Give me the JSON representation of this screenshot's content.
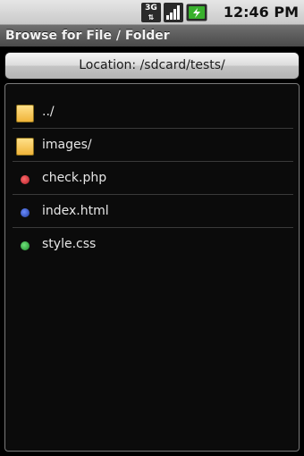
{
  "status_bar": {
    "network_icon": "3g-data-icon",
    "network_label": "3G",
    "signal_icon": "cell-signal-icon",
    "battery_icon": "battery-charging-icon",
    "time": "12:46 PM"
  },
  "title_bar": {
    "title": "Browse for File / Folder"
  },
  "location": {
    "label": "Location: /sdcard/tests/"
  },
  "files": [
    {
      "name": "../",
      "icon": "folder-icon",
      "color": "#f0b43a"
    },
    {
      "name": "images/",
      "icon": "folder-icon",
      "color": "#f0b43a"
    },
    {
      "name": "check.php",
      "icon": "red-dot-icon",
      "color": "#c8343c"
    },
    {
      "name": "index.html",
      "icon": "blue-dot-icon",
      "color": "#2f4fb8"
    },
    {
      "name": "style.css",
      "icon": "green-dot-icon",
      "color": "#2f9a3a"
    }
  ],
  "colors": {
    "status_bar": "#d4d4d4",
    "title_bar": "#5a5a5a",
    "list_background": "#0b0b0b",
    "text": "#e6e6e6"
  }
}
